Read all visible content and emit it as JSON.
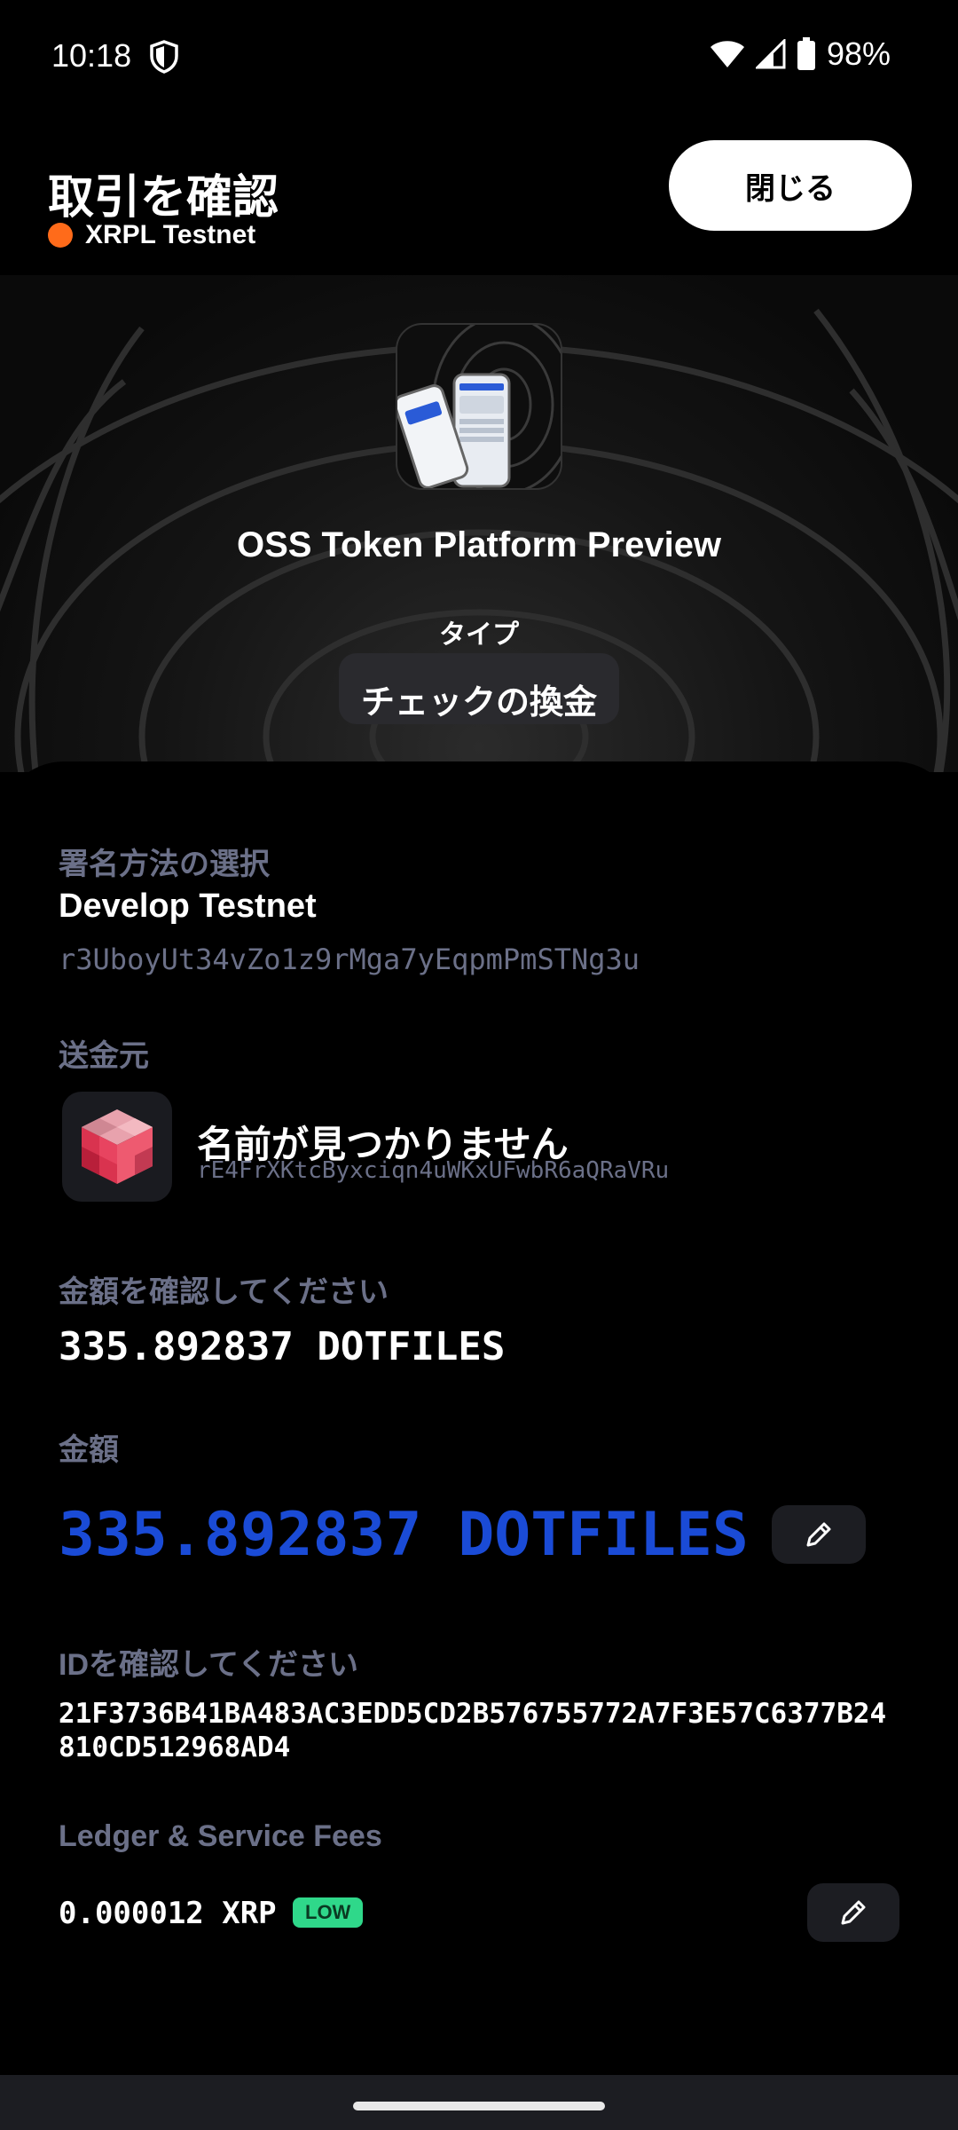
{
  "status_bar": {
    "time": "10:18",
    "battery": "98%"
  },
  "header": {
    "title": "取引を確認",
    "network": "XRPL Testnet",
    "network_color": "#ff6b1a",
    "close_label": "閉じる"
  },
  "hero": {
    "app_name": "OSS Token Platform Preview",
    "type_label": "タイプ",
    "type_value": "チェックの換金"
  },
  "signer": {
    "label": "署名方法の選択",
    "name": "Develop Testnet",
    "address": "r3UboyUt34vZo1z9rMga7yEqpmPmSTNg3u"
  },
  "sender": {
    "label": "送金元",
    "name": "名前が見つかりません",
    "address": "rE4FrXKtcByxciqn4uWKxUFwbR6aQRaVRu"
  },
  "amount_confirm": {
    "label": "金額を確認してください",
    "value": "335.892837 DOTFILES"
  },
  "amount": {
    "label": "金額",
    "value": "335.892837 DOTFILES",
    "color": "#1a4bd6"
  },
  "id_confirm": {
    "label": "IDを確認してください",
    "value": "21F3736B41BA483AC3EDD5CD2B576755772A7F3E57C6377B24810CD512968AD4"
  },
  "fees": {
    "label": "Ledger & Service Fees",
    "value": "0.000012 XRP",
    "badge": "LOW",
    "badge_color": "#2fd88a"
  }
}
